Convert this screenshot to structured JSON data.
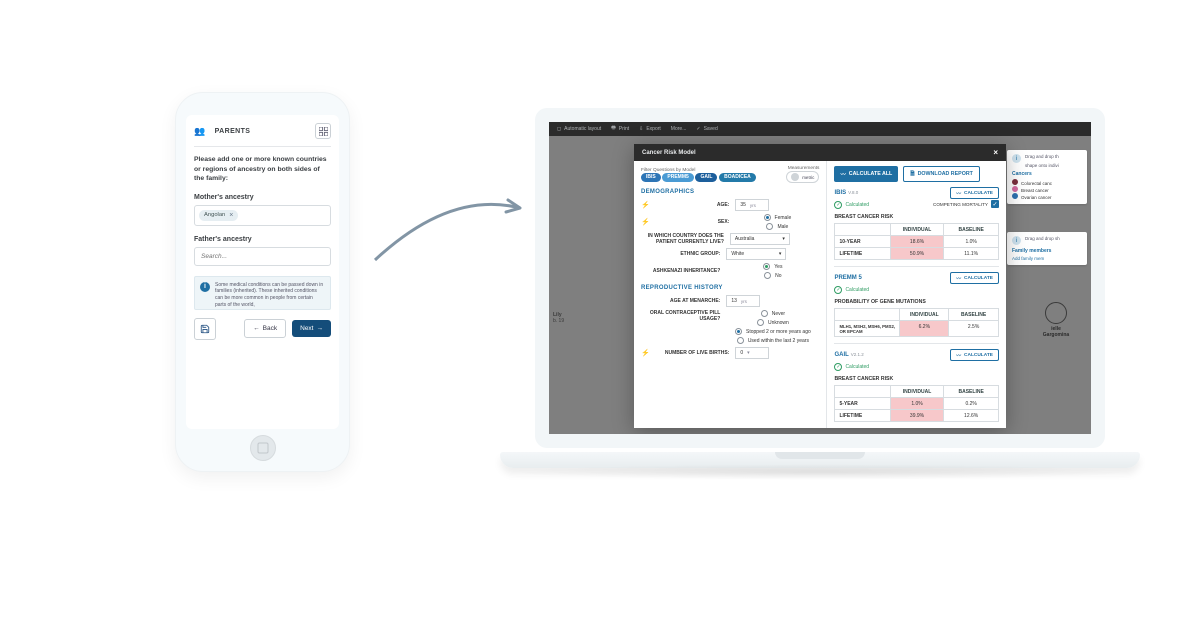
{
  "phone": {
    "section_label": "PARENTS",
    "intro": "Please add one or more known countries or regions of ancestry on both sides of the family:",
    "mother_label": "Mother's ancestry",
    "mother_chip": "Angolan",
    "father_label": "Father's ancestry",
    "search_placeholder": "Search...",
    "info_text": "Some medical conditions can be passed down in families (inherited). These inherited conditions can be more common in people from certain parts of the world,",
    "back_label": "Back",
    "next_label": "Next"
  },
  "laptop": {
    "toolbar": {
      "auto_layout": "Automatic layout",
      "print": "Print",
      "export": "Export",
      "more": "More...",
      "saved": "Saved"
    },
    "modal_title": "Cancer Risk Model",
    "filters": {
      "label": "Filter Questions by Model",
      "ibis": "IBIS",
      "premm": "PREMM5",
      "gail": "GAIL",
      "boadicea": "BOADICEA",
      "measurements_label": "Measurements",
      "metric": "metric"
    },
    "demographics": {
      "header": "DEMOGRAPHICS",
      "age_label": "AGE:",
      "age_value": "35",
      "age_unit": "yrs",
      "sex_label": "SEX:",
      "sex_female": "Female",
      "sex_male": "Male",
      "country_label": "IN WHICH COUNTRY DOES THE PATIENT CURRENTLY LIVE?",
      "country_value": "Australia",
      "ethnic_label": "ETHNIC GROUP:",
      "ethnic_value": "White",
      "ashk_label": "ASHKENAZI INHERITANCE?",
      "yes": "Yes",
      "no": "No"
    },
    "reproductive": {
      "header": "REPRODUCTIVE HISTORY",
      "menarche_label": "AGE AT MENARCHE:",
      "menarche_value": "13",
      "menarche_unit": "yrs",
      "ocp_label": "ORAL CONTRACEPTIVE PILL USAGE?",
      "ocp_never": "Never",
      "ocp_unknown": "Unknown",
      "ocp_stopped": "Stopped 2 or more years ago",
      "ocp_recent": "Used within the last 2 years",
      "births_label": "NUMBER OF LIVE BIRTHS:",
      "births_value": "0"
    },
    "right": {
      "calc_all": "CALCULATE ALL",
      "download_report": "DOWNLOAD REPORT",
      "calculated": "Calculated",
      "calculate_btn": "CALCULATE",
      "individual": "INDIVIDUAL",
      "baseline": "BASELINE",
      "ibis": {
        "name": "IBIS",
        "ver": "V.8.0",
        "comp_mort": "COMPETING MORTALITY",
        "risk_title": "BREAST CANCER RISK",
        "row1_label": "10-YEAR",
        "row1_ind": "18.6%",
        "row1_base": "1.0%",
        "row2_label": "LIFETIME",
        "row2_ind": "50.9%",
        "row2_base": "11.1%"
      },
      "premm": {
        "name": "PREMM 5",
        "risk_title": "PROBABILITY OF GENE MUTATIONS",
        "row1_label": "MLH1, MSH2, MSH6, PMS2, OR EPCAM",
        "row1_ind": "6.2%",
        "row1_base": "2.5%"
      },
      "gail": {
        "name": "GAIL",
        "ver": "V2.1.2",
        "risk_title": "BREAST CANCER RISK",
        "row1_label": "5-YEAR",
        "row1_ind": "1.0%",
        "row1_base": "0.2%",
        "row2_label": "LIFETIME",
        "row2_ind": "39.9%",
        "row2_base": "12.6%"
      }
    },
    "bg": {
      "left_name": "Lily",
      "left_sub": "b. 19",
      "right_name": "ielle Gargomina",
      "cancers_title": "Cancers",
      "c1": "Colorectal canc",
      "c2": "Breast cancer",
      "c3": "Ovarian cancer",
      "tip1": "Drag and drop th",
      "tip1b": "shape onto indivi",
      "tip2": "Drag and drop sh",
      "fam_title": "Family members",
      "fam_add": "Add family mem"
    }
  }
}
